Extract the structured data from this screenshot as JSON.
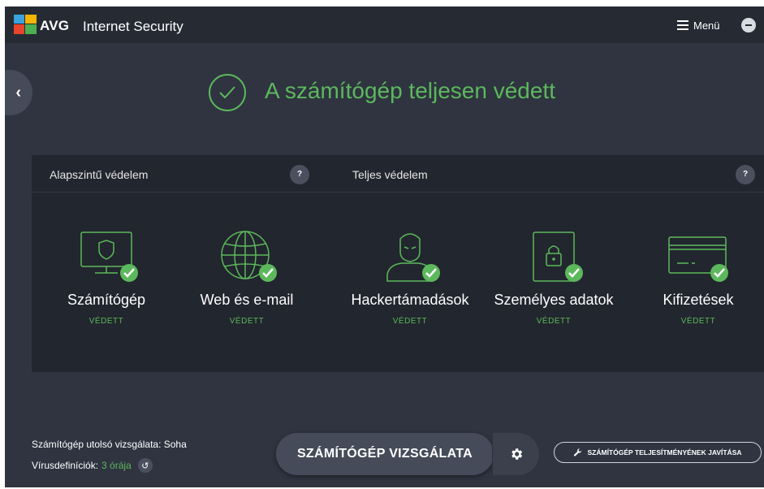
{
  "app": {
    "brand": "AVG",
    "product": "Internet Security"
  },
  "titlebar": {
    "menu_label": "Menü"
  },
  "hero": {
    "text": "A számítógép teljesen védett"
  },
  "panels": {
    "basic": {
      "title": "Alapszintű védelem",
      "help": "?"
    },
    "full": {
      "title": "Teljes védelem",
      "help": "?"
    }
  },
  "items": [
    {
      "name": "Számítógép",
      "status": "VÉDETT",
      "icon": "computer-shield-icon"
    },
    {
      "name": "Web és e-mail",
      "status": "VÉDETT",
      "icon": "globe-icon"
    },
    {
      "name": "Hackertámadások",
      "status": "VÉDETT",
      "icon": "hacker-icon"
    },
    {
      "name": "Személyes adatok",
      "status": "VÉDETT",
      "icon": "lock-document-icon"
    },
    {
      "name": "Kifizetések",
      "status": "VÉDETT",
      "icon": "credit-card-icon"
    }
  ],
  "bottom": {
    "last_scan": "Számítógép utolsó vizsgálata: Soha",
    "virus_defs_label": "Vírusdefiníciók:",
    "virus_defs_value": "3 órája",
    "scan_button": "SZÁMÍTÓGÉP VIZSGÁLATA",
    "tune_button": "SZÁMÍTÓGÉP TELJESÍTMÉNYÉNEK JAVÍTÁSA"
  },
  "colors": {
    "accent": "#5cb85c",
    "background": "#2f3440",
    "panel": "#22262e",
    "titlebar": "#262a33"
  }
}
